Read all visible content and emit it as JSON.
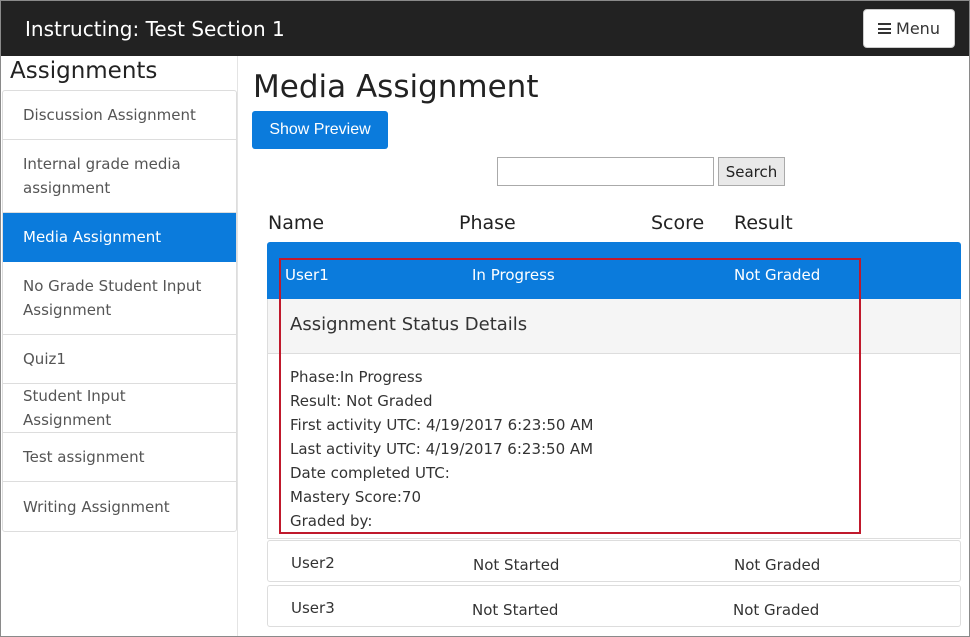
{
  "header": {
    "title": "Instructing: Test Section 1",
    "menu_label": "Menu"
  },
  "sidebar": {
    "heading": "Assignments",
    "items": [
      {
        "label": "Discussion Assignment"
      },
      {
        "label": "Internal grade media assignment"
      },
      {
        "label": "Media Assignment"
      },
      {
        "label": "No Grade Student Input Assignment"
      },
      {
        "label": "Quiz1"
      },
      {
        "label": "Student Input Assignment"
      },
      {
        "label": "Test assignment"
      },
      {
        "label": "Writing Assignment"
      }
    ]
  },
  "main": {
    "title": "Media Assignment",
    "preview_button": "Show Preview",
    "search": {
      "value": "",
      "button": "Search"
    },
    "columns": [
      "Name",
      "Phase",
      "Score",
      "Result"
    ],
    "rows": [
      {
        "name": "User1",
        "phase": "In Progress",
        "score": "",
        "result": "Not Graded"
      },
      {
        "name": "User2",
        "phase": "Not Started",
        "score": "",
        "result": "Not Graded"
      },
      {
        "name": "User3",
        "phase": "Not Started",
        "score": "",
        "result": "Not Graded"
      }
    ],
    "details": {
      "title": "Assignment Status Details",
      "lines": [
        "Phase:In Progress",
        "Result: Not Graded",
        "First activity UTC: 4/19/2017 6:23:50 AM",
        "Last activity UTC: 4/19/2017 6:23:50 AM",
        "Date completed UTC:",
        "Mastery Score:70",
        "Graded by:"
      ]
    }
  },
  "colors": {
    "navbar": "#222222",
    "accent": "#0b7bdc",
    "highlight": "#c0192c"
  }
}
